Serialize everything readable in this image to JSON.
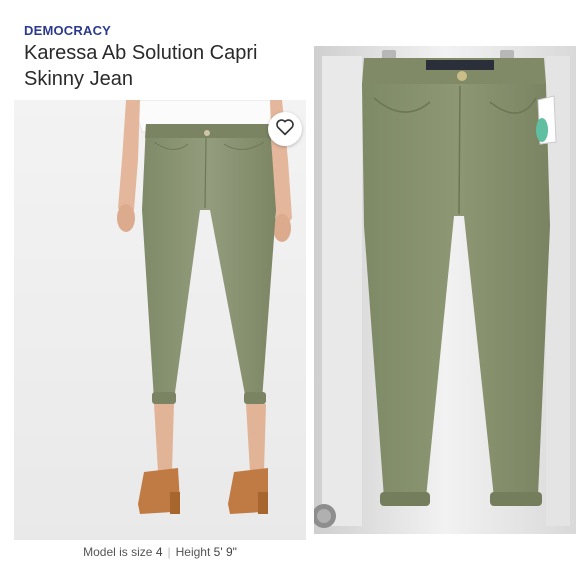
{
  "product": {
    "brand": "DEMOCRACY",
    "title": "Karessa Ab Solution Capri Skinny Jean"
  },
  "model_info": {
    "size_prefix": "Model is size",
    "size": "4",
    "height_prefix": "Height",
    "height": "5' 9\""
  },
  "colors": {
    "brand_text": "#2b3a8f",
    "pants": "#8a9474",
    "sandals": "#c07a43"
  },
  "icons": {
    "wishlist": "heart-outline-icon"
  }
}
